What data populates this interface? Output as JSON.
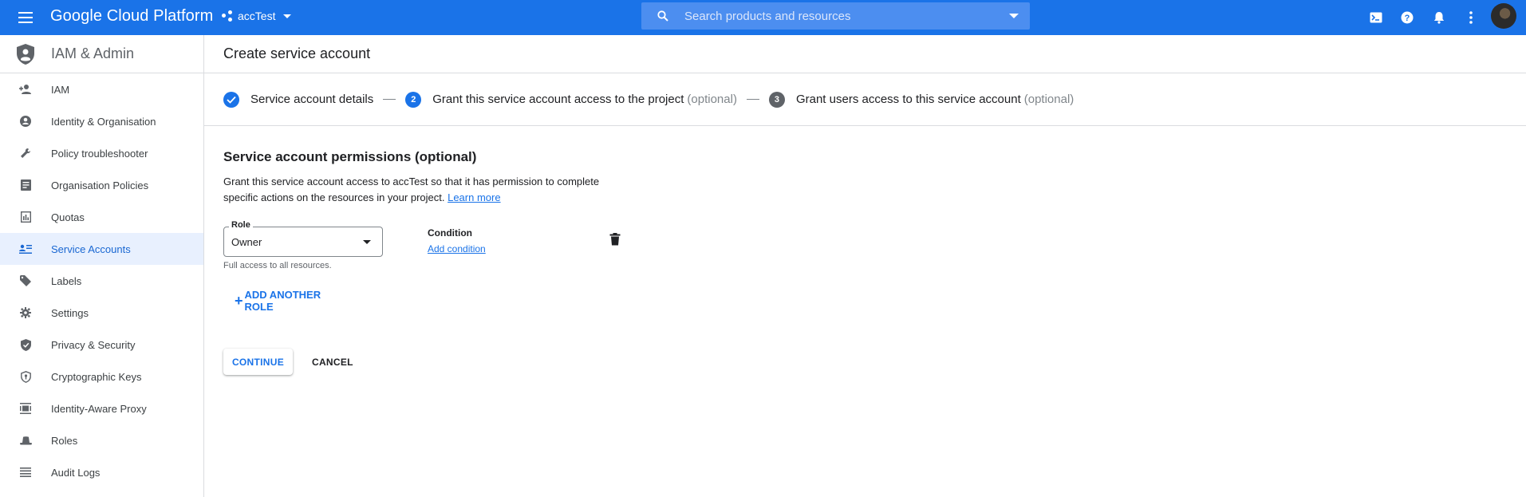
{
  "topbar": {
    "brand": "Google Cloud Platform",
    "project": "accTest",
    "search_placeholder": "Search products and resources",
    "accent_color": "#1a73e8"
  },
  "sidebar": {
    "title": "IAM & Admin",
    "items": [
      {
        "label": "IAM",
        "icon": "person-add-icon"
      },
      {
        "label": "Identity & Organisation",
        "icon": "account-circle-icon"
      },
      {
        "label": "Policy troubleshooter",
        "icon": "wrench-icon"
      },
      {
        "label": "Organisation Policies",
        "icon": "document-icon"
      },
      {
        "label": "Quotas",
        "icon": "quota-icon"
      },
      {
        "label": "Service Accounts",
        "icon": "service-account-icon",
        "active": true
      },
      {
        "label": "Labels",
        "icon": "tag-icon"
      },
      {
        "label": "Settings",
        "icon": "gear-icon"
      },
      {
        "label": "Privacy & Security",
        "icon": "shield-check-icon"
      },
      {
        "label": "Cryptographic Keys",
        "icon": "key-shield-icon"
      },
      {
        "label": "Identity-Aware Proxy",
        "icon": "proxy-icon"
      },
      {
        "label": "Roles",
        "icon": "hat-icon"
      },
      {
        "label": "Audit Logs",
        "icon": "list-icon"
      }
    ]
  },
  "main": {
    "title": "Create service account",
    "steps": [
      {
        "label": "Service account details",
        "optional": "",
        "status": "done"
      },
      {
        "number": "2",
        "label": "Grant this service account access to the project",
        "optional": "(optional)",
        "status": "current"
      },
      {
        "number": "3",
        "label": "Grant users access to this service account",
        "optional": "(optional)",
        "status": "pending"
      }
    ],
    "section_title": "Service account permissions (optional)",
    "description": "Grant this service account access to accTest so that it has permission to complete specific actions on the resources in your project.",
    "learn_more": "Learn more",
    "role_label": "Role",
    "role_value": "Owner",
    "role_help": "Full access to all resources.",
    "condition_label": "Condition",
    "add_condition": "Add condition",
    "add_another_role": "ADD ANOTHER ROLE",
    "continue": "CONTINUE",
    "cancel": "CANCEL"
  }
}
